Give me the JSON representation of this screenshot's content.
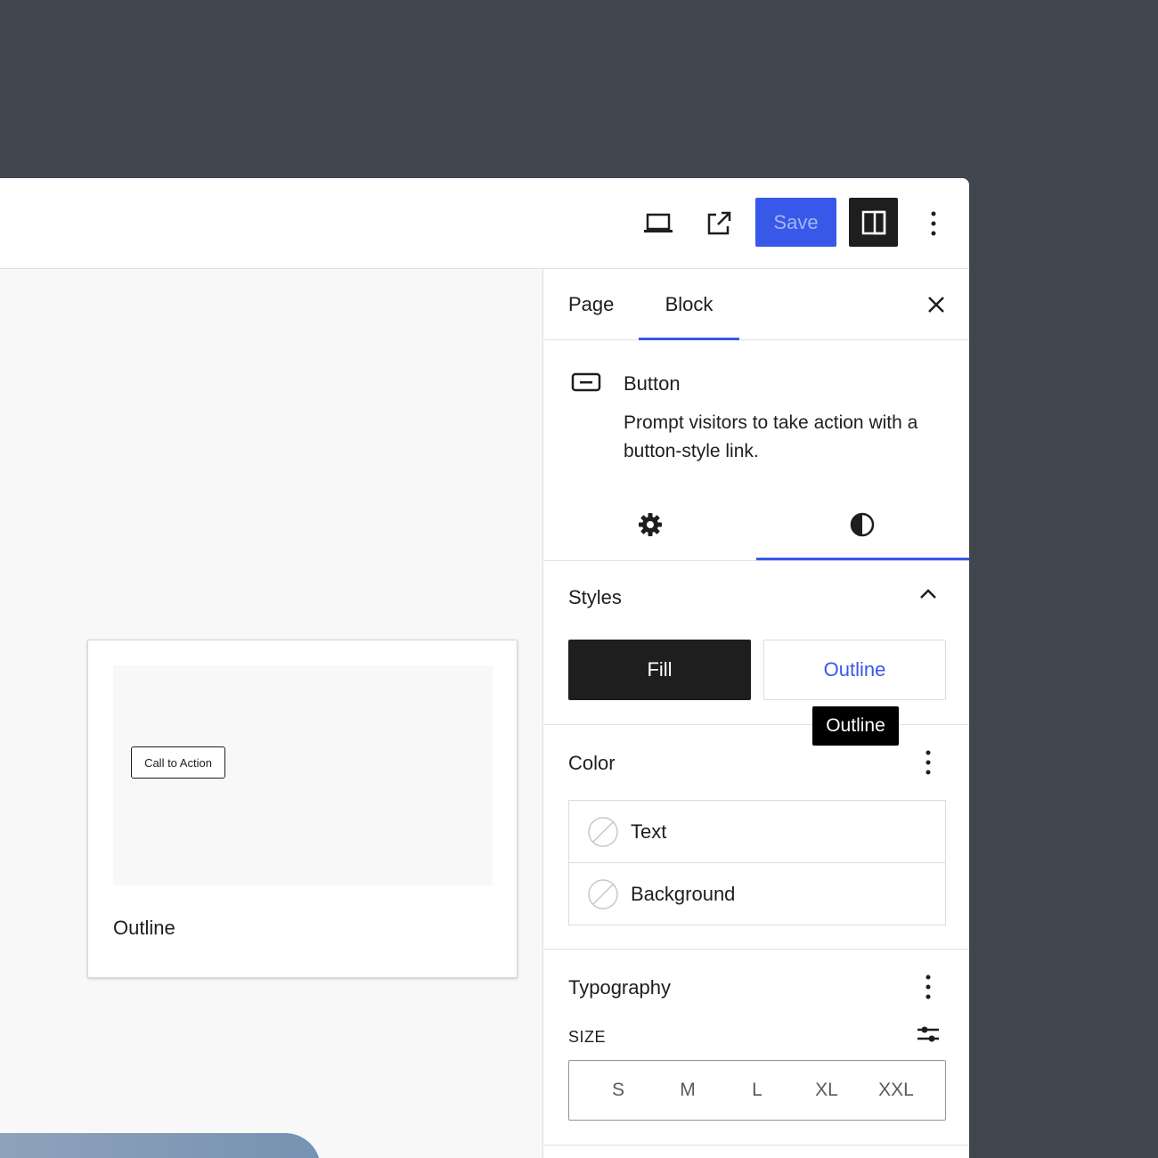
{
  "toolbar": {
    "device_icon": "laptop-icon",
    "external_icon": "external-link-icon",
    "save_label": "Save",
    "sidebar_icon": "sidebar-toggle-icon",
    "options_icon": "more-vertical-icon",
    "colors": {
      "save_bg": "#3858e9",
      "toggle_bg": "#1e1e1e"
    }
  },
  "canvas": {
    "cta_label": "Call to Action",
    "preview_label": "Outline"
  },
  "sidebar": {
    "tabs": [
      {
        "label": "Page"
      },
      {
        "label": "Block"
      }
    ],
    "block": {
      "icon": "button-block-icon",
      "title": "Button",
      "description": "Prompt visitors to take action with a button-style link."
    },
    "sub_tabs": [
      {
        "icon": "gear-icon"
      },
      {
        "icon": "contrast-icon"
      }
    ],
    "styles": {
      "title": "Styles",
      "options": [
        {
          "label": "Fill"
        },
        {
          "label": "Outline"
        }
      ],
      "tooltip": "Outline"
    },
    "color": {
      "title": "Color",
      "items": [
        {
          "label": "Text"
        },
        {
          "label": "Background"
        }
      ]
    },
    "typography": {
      "title": "Typography",
      "size_label": "SIZE",
      "sizes": [
        "S",
        "M",
        "L",
        "XL",
        "XXL"
      ]
    },
    "accent_color": "#3858e9"
  }
}
